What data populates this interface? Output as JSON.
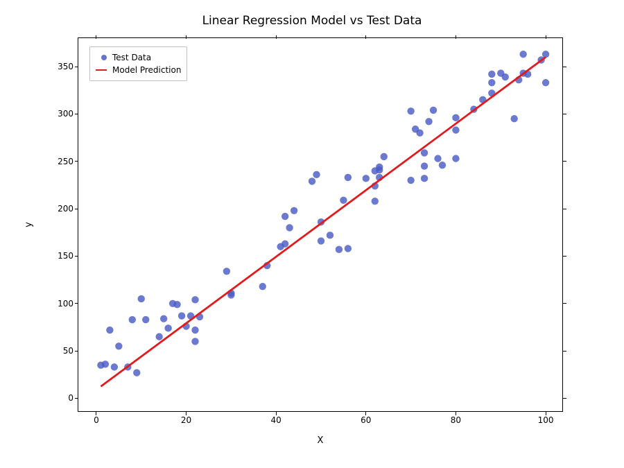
{
  "chart_data": {
    "type": "scatter",
    "title": "Linear Regression Model vs Test Data",
    "xlabel": "X",
    "ylabel": "y",
    "xlim": [
      -4,
      104
    ],
    "ylim": [
      -15,
      380
    ],
    "xticks": [
      0,
      20,
      40,
      60,
      80,
      100
    ],
    "yticks": [
      0,
      50,
      100,
      150,
      200,
      250,
      300,
      350
    ],
    "series": [
      {
        "name": "Test Data",
        "type": "scatter",
        "color": "#4a5cc4",
        "x": [
          1,
          2,
          3,
          4,
          5,
          7,
          8,
          9,
          10,
          11,
          14,
          15,
          16,
          17,
          18,
          19,
          20,
          21,
          22,
          22,
          22,
          23,
          29,
          30,
          30,
          37,
          38,
          41,
          42,
          42,
          43,
          44,
          48,
          49,
          50,
          50,
          52,
          54,
          55,
          56,
          56,
          60,
          62,
          62,
          62,
          63,
          63,
          63,
          64,
          70,
          70,
          71,
          72,
          73,
          73,
          73,
          74,
          75,
          76,
          77,
          80,
          80,
          80,
          84,
          86,
          88,
          88,
          88,
          90,
          91,
          93,
          94,
          95,
          95,
          96,
          99,
          100,
          100
        ],
        "y": [
          35,
          36,
          72,
          33,
          55,
          33,
          83,
          27,
          105,
          83,
          65,
          84,
          74,
          100,
          99,
          87,
          76,
          87,
          104,
          72,
          60,
          86,
          134,
          109,
          111,
          118,
          140,
          160,
          163,
          192,
          180,
          198,
          229,
          236,
          186,
          166,
          172,
          157,
          209,
          158,
          233,
          232,
          240,
          224,
          208,
          241,
          233,
          244,
          255,
          303,
          230,
          284,
          280,
          232,
          259,
          245,
          292,
          304,
          253,
          246,
          283,
          253,
          296,
          305,
          315,
          342,
          322,
          333,
          343,
          339,
          295,
          336,
          363,
          343,
          342,
          357,
          333,
          363
        ]
      },
      {
        "name": "Model Prediction",
        "type": "line",
        "color": "#e31a1c",
        "x": [
          1,
          100
        ],
        "y": [
          12.5,
          360
        ]
      }
    ],
    "legend": {
      "position": "upper left",
      "items": [
        "Test Data",
        "Model Prediction"
      ]
    }
  },
  "title": "Linear Regression Model vs Test Data",
  "xlabel": "X",
  "ylabel": "y",
  "xticks": [
    "0",
    "20",
    "40",
    "60",
    "80",
    "100"
  ],
  "yticks": [
    "0",
    "50",
    "100",
    "150",
    "200",
    "250",
    "300",
    "350"
  ],
  "legend_scatter": "Test Data",
  "legend_line": "Model Prediction",
  "colors": {
    "scatter": "#4a5cc4",
    "line": "#e31a1c"
  }
}
